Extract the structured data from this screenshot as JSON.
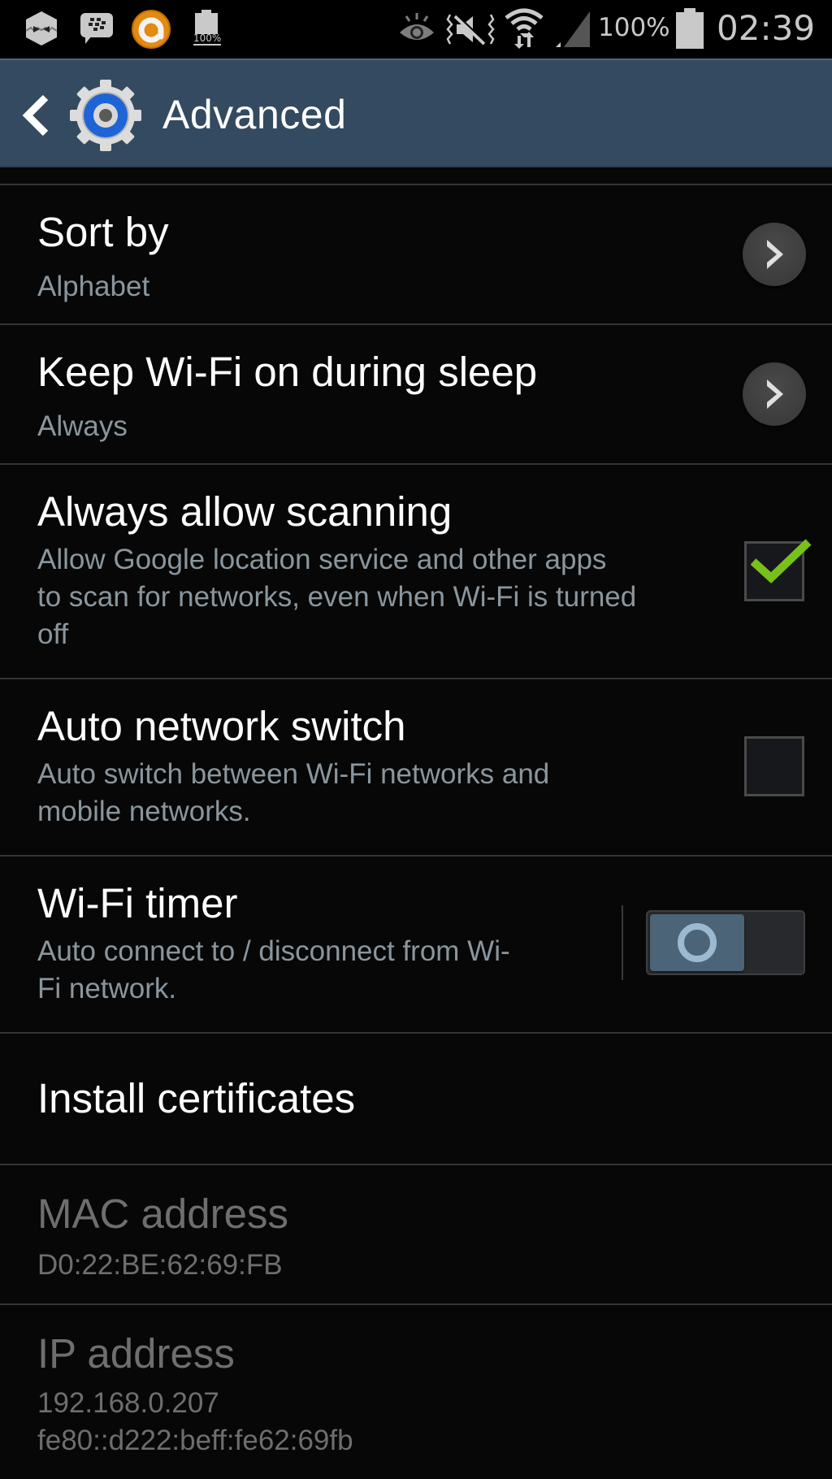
{
  "status_bar": {
    "notification_icons": [
      "hexagon-face-icon",
      "bbm-chat-icon",
      "orange-app-icon",
      "battery-full-notification-icon"
    ],
    "battery_notification_label": "100%",
    "system_icons": [
      "eye-smart-stay-icon",
      "mute-vibrate-icon",
      "wifi-data-icon",
      "signal-icon"
    ],
    "battery_percent": "100%",
    "time": "02:39"
  },
  "action_bar": {
    "title": "Advanced",
    "back_icon": "chevron-left-icon",
    "app_icon": "settings-gear-icon"
  },
  "settings": [
    {
      "id": "sort-by",
      "title": "Sort by",
      "summary": "Alphabet",
      "control": "chevron"
    },
    {
      "id": "keep-wifi-on",
      "title": "Keep Wi-Fi on during sleep",
      "summary": "Always",
      "control": "chevron"
    },
    {
      "id": "always-allow-scanning",
      "title": "Always allow scanning",
      "summary_lines": [
        "Allow Google location service and other apps",
        "to scan for networks, even when Wi-Fi is turned",
        "off"
      ],
      "control": "checkbox",
      "checked": true
    },
    {
      "id": "auto-network-switch",
      "title": "Auto network switch",
      "summary_lines": [
        "Auto switch between Wi-Fi networks and",
        "mobile networks."
      ],
      "control": "checkbox",
      "checked": false
    },
    {
      "id": "wifi-timer",
      "title": "Wi-Fi timer",
      "summary_lines": [
        "Auto connect to / disconnect from Wi-",
        "Fi network."
      ],
      "control": "switch",
      "on": false
    },
    {
      "id": "install-certificates",
      "title": "Install certificates"
    },
    {
      "id": "mac-address",
      "title": "MAC address",
      "summary": "D0:22:BE:62:69:FB",
      "disabled": true
    },
    {
      "id": "ip-address",
      "title": "IP address",
      "summary_lines": [
        "192.168.0.207",
        "fe80::d222:beff:fe62:69fb"
      ],
      "disabled": true
    }
  ],
  "colors": {
    "action_bar": "#344a60",
    "check_green": "#78c01a",
    "summary_text": "#8a969e",
    "disabled_text": "#6e6e6e"
  }
}
